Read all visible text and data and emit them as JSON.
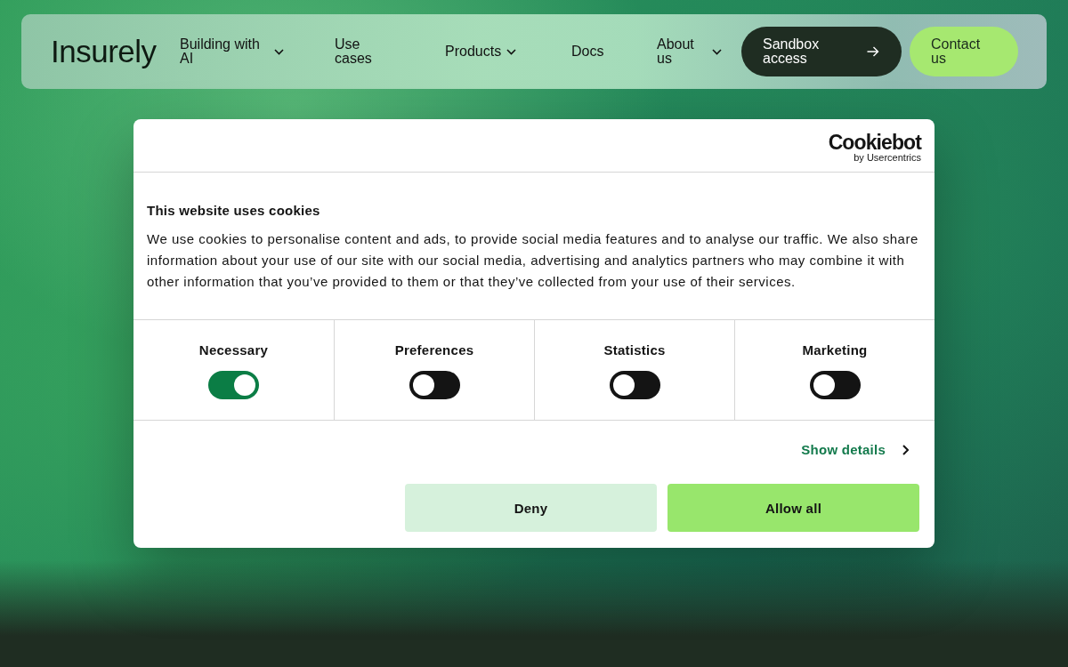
{
  "nav": {
    "logo": "Insurely",
    "items": [
      {
        "label": "Building with AI",
        "dropdown": true
      },
      {
        "label": "Use cases",
        "dropdown": false
      },
      {
        "label": "Products",
        "dropdown": true
      },
      {
        "label": "Docs",
        "dropdown": false
      },
      {
        "label": "About us",
        "dropdown": true
      }
    ],
    "buttons": [
      {
        "label": "Sandbox access",
        "kind": "primary"
      },
      {
        "label": "Contact us",
        "kind": "secondary"
      }
    ]
  },
  "cookie_dialog": {
    "provider": {
      "logo": "Cookiebot",
      "byline": "by Usercentrics"
    },
    "title": "This website uses cookies",
    "description": "We use cookies to personalise content and ads, to provide social media features and to analyse our traffic. We also share information about your use of our site with our social media, advertising and analytics partners who may combine it with other information that you’ve provided to them or that they’ve collected from your use of their services.",
    "categories": [
      {
        "label": "Necessary",
        "on": true
      },
      {
        "label": "Preferences",
        "on": false
      },
      {
        "label": "Statistics",
        "on": false
      },
      {
        "label": "Marketing",
        "on": false
      }
    ],
    "details_link": "Show details",
    "buttons": [
      {
        "label": "Deny",
        "kind": "deny"
      },
      {
        "label": "Allow all",
        "kind": "allow"
      }
    ]
  }
}
